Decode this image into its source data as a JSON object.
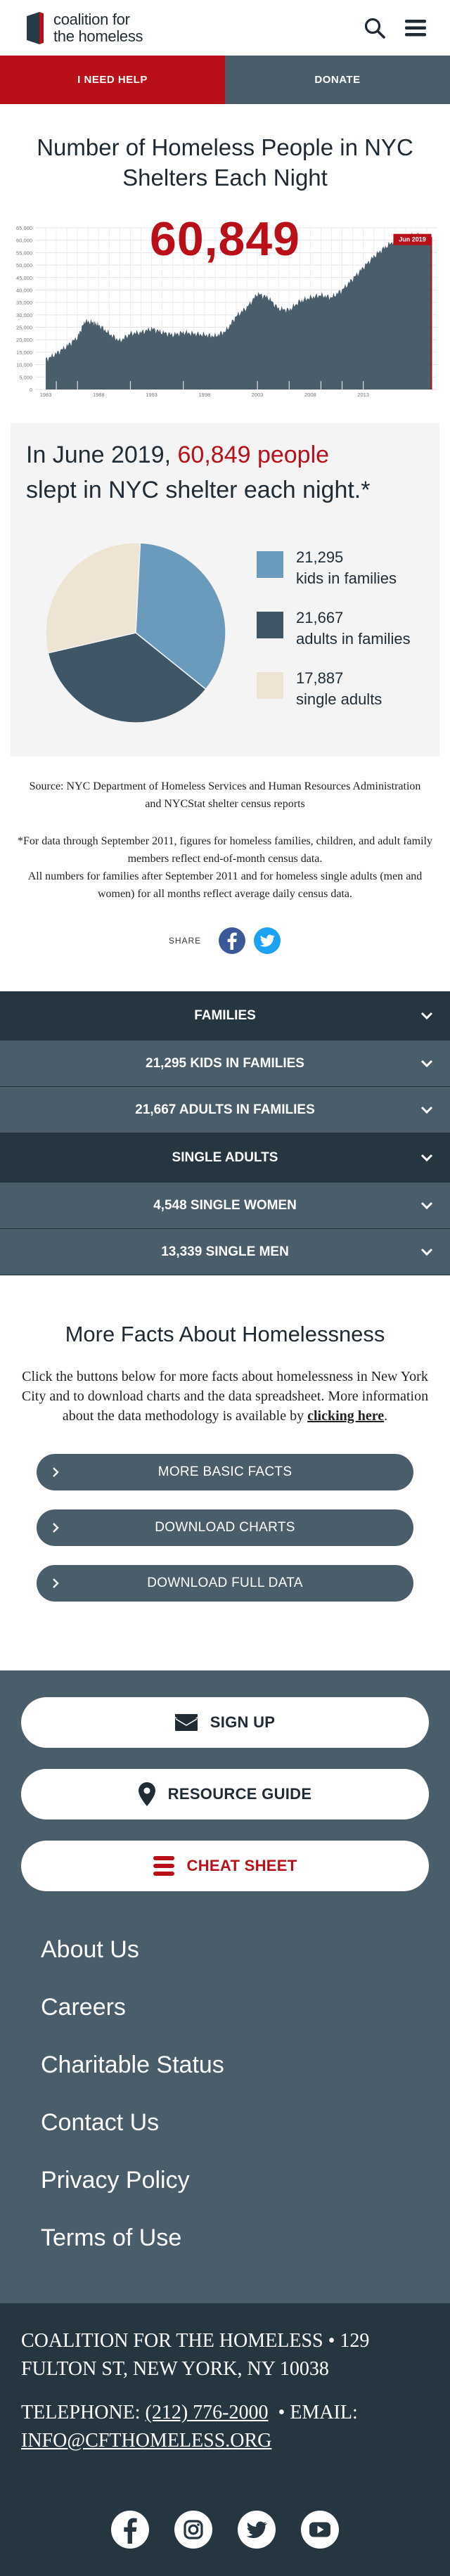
{
  "header": {
    "logo_line1": "coalition for",
    "logo_line2": "the homeless",
    "need_help": "I NEED HELP",
    "donate": "DONATE"
  },
  "main": {
    "title": "Number of Homeless People in NYC Shelters Each Night",
    "big_number": "60,849",
    "latest_label": "Jun 2019"
  },
  "chart_data": {
    "type": "area",
    "color": "#4a5d6b",
    "highlight_color": "#b80f19",
    "ylim": [
      0,
      65000
    ],
    "y_ticks": [
      "0",
      "5,000",
      "10,000",
      "15,000",
      "20,000",
      "25,000",
      "30,000",
      "35,000",
      "40,000",
      "45,000",
      "50,000",
      "55,000",
      "60,000",
      "65,000"
    ],
    "x_ticks": [
      "1983",
      "1988",
      "1993",
      "1998",
      "2003",
      "2008",
      "2013"
    ],
    "x": [
      1983,
      1984,
      1985,
      1986,
      1986.7,
      1987.5,
      1988,
      1989,
      1990,
      1991,
      1992,
      1993,
      1994,
      1995,
      1996,
      1997,
      1998,
      1999,
      2000,
      2001,
      2002,
      2003,
      2004,
      2005,
      2006,
      2007,
      2008,
      2009,
      2010,
      2011,
      2012,
      2013,
      2014,
      2015,
      2016,
      2017,
      2018,
      2019.5
    ],
    "values": [
      12000,
      14500,
      17500,
      21000,
      27500,
      27000,
      26000,
      22500,
      19500,
      22500,
      23000,
      24500,
      23000,
      22000,
      23000,
      22500,
      22000,
      21500,
      23500,
      29500,
      33000,
      38500,
      37000,
      32500,
      32000,
      35500,
      37000,
      38000,
      37000,
      40000,
      44500,
      49000,
      53500,
      57000,
      60000,
      61500,
      62000,
      60849
    ]
  },
  "stats": {
    "head_prefix": "In June 2019,",
    "head_number": "60,849 people",
    "head_suffix": "slept in NYC shelter each night.*",
    "items": [
      {
        "value": "21,295",
        "label": "kids in families",
        "color": "#6a9bbd",
        "count": 21295
      },
      {
        "value": "21,667",
        "label": "adults in families",
        "color": "#3f5666",
        "count": 21667
      },
      {
        "value": "17,887",
        "label": "single adults",
        "color": "#ede4d3",
        "count": 17887
      }
    ]
  },
  "source": "Source: NYC Department of Homeless Services and Human Resources Administration and NYCStat shelter census reports",
  "note1": "*For data through September 2011, figures for homeless families, children, and adult family members reflect end-of-month census data.",
  "note2": "All numbers for families after September 2011 and for homeless single adults (men and women) for all months reflect average daily census data.",
  "share_label": "SHARE",
  "accordion": {
    "families": "FAMILIES",
    "kids": "21,295 KIDS IN FAMILIES",
    "adults": "21,667 ADULTS IN FAMILIES",
    "singles": "SINGLE ADULTS",
    "women": "4,548 SINGLE WOMEN",
    "men": "13,339 SINGLE MEN"
  },
  "facts": {
    "title": "More Facts About Homelessness",
    "body": "Click the buttons below for more facts about homelessness in New York City and to download charts and the data spreadsheet. More information about the data methodology is available by",
    "link": "clicking here",
    "btn1": "MORE BASIC FACTS",
    "btn2": "DOWNLOAD CHARTS",
    "btn3": "DOWNLOAD FULL DATA"
  },
  "footer": {
    "signup": "SIGN UP",
    "resource": "RESOURCE GUIDE",
    "cheat": "CHEAT SHEET",
    "links": [
      "About Us",
      "Careers",
      "Charitable Status",
      "Contact Us",
      "Privacy Policy",
      "Terms of Use"
    ],
    "address": "COALITION FOR THE HOMELESS • 129 FULTON ST, NEW YORK, NY 10038",
    "tel_label": "TELEPHONE:",
    "tel": "(212) 776-2000",
    "email_label": "• EMAIL:",
    "email": "INFO@CFTHOMELESS.ORG"
  }
}
